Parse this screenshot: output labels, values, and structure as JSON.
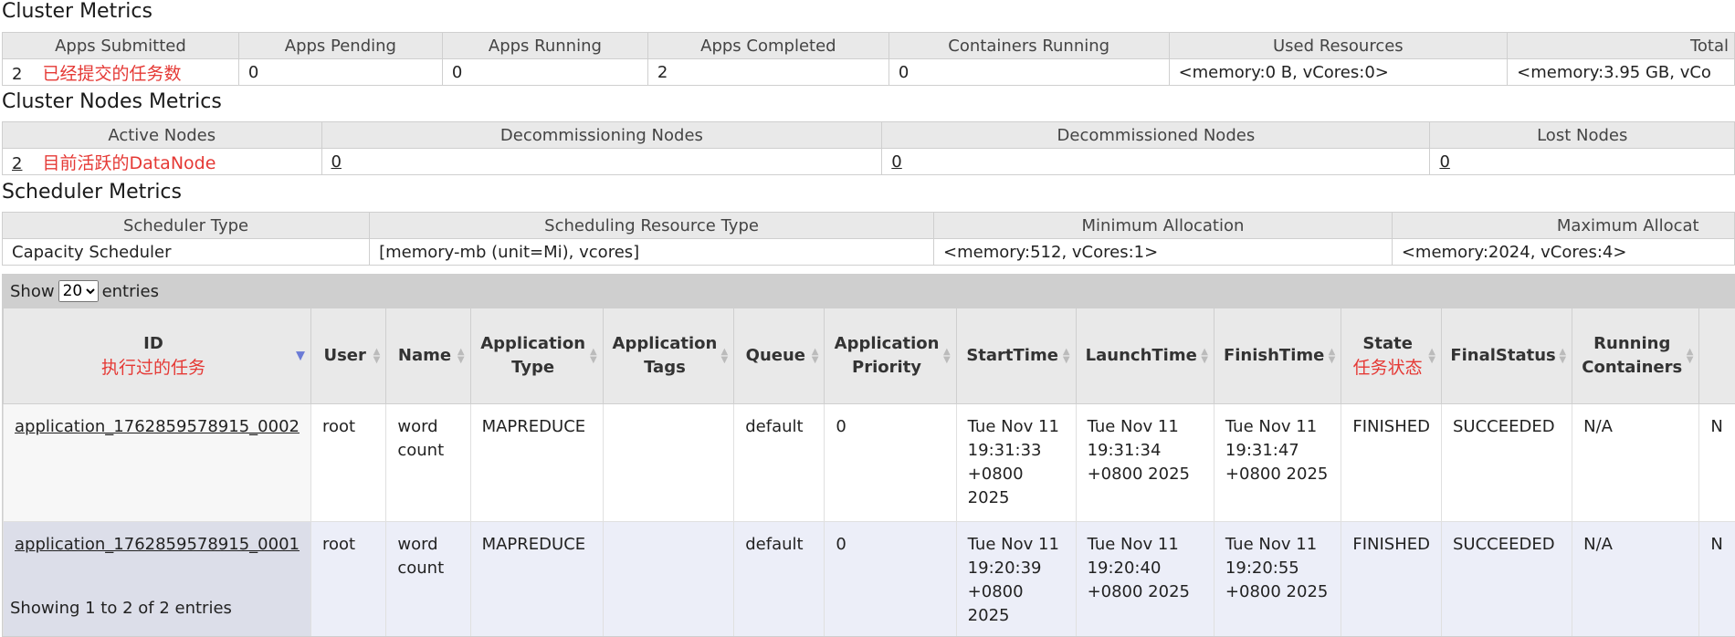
{
  "cluster_metrics": {
    "title": "Cluster Metrics",
    "headers": [
      "Apps Submitted",
      "Apps Pending",
      "Apps Running",
      "Apps Completed",
      "Containers Running",
      "Used Resources",
      "Total"
    ],
    "values": [
      "2",
      "0",
      "0",
      "2",
      "0",
      "<memory:0 B, vCores:0>",
      "<memory:3.95 GB, vCo"
    ],
    "note": "已经提交的任务数"
  },
  "nodes_metrics": {
    "title": "Cluster Nodes Metrics",
    "headers": [
      "Active Nodes",
      "Decommissioning Nodes",
      "Decommissioned Nodes",
      "Lost Nodes"
    ],
    "values": [
      "2",
      "0",
      "0",
      "0"
    ],
    "note": "目前活跃的DataNode"
  },
  "scheduler_metrics": {
    "title": "Scheduler Metrics",
    "headers": [
      "Scheduler Type",
      "Scheduling Resource Type",
      "Minimum Allocation",
      "Maximum Allocat"
    ],
    "values": [
      "Capacity Scheduler",
      "[memory-mb (unit=Mi), vcores]",
      "<memory:512, vCores:1>",
      "<memory:2024, vCores:4>"
    ]
  },
  "apps_table": {
    "show_label": "Show",
    "entries_value": "20",
    "entries_label": "entries",
    "headers": {
      "id": "ID",
      "id_note": "执行过的任务",
      "user": "User",
      "name": "Name",
      "app_type": "Application Type",
      "app_tags": "Application Tags",
      "queue": "Queue",
      "priority": "Application Priority",
      "start": "StartTime",
      "launch": "LaunchTime",
      "finish": "FinishTime",
      "state": "State",
      "state_note": "任务状态",
      "final_status": "FinalStatus",
      "running": "Running Containers"
    },
    "rows": [
      {
        "id": "application_1762859578915_0002",
        "user": "root",
        "name": "word count",
        "type": "MAPREDUCE",
        "tags": "",
        "queue": "default",
        "priority": "0",
        "start": "Tue Nov 11 19:31:33 +0800 2025",
        "launch": "Tue Nov 11 19:31:34 +0800 2025",
        "finish": "Tue Nov 11 19:31:47 +0800 2025",
        "state": "FINISHED",
        "final_status": "SUCCEEDED",
        "running": "N/A",
        "next": "N"
      },
      {
        "id": "application_1762859578915_0001",
        "user": "root",
        "name": "word count",
        "type": "MAPREDUCE",
        "tags": "",
        "queue": "default",
        "priority": "0",
        "start": "Tue Nov 11 19:20:39 +0800 2025",
        "launch": "Tue Nov 11 19:20:40 +0800 2025",
        "finish": "Tue Nov 11 19:20:55 +0800 2025",
        "state": "FINISHED",
        "final_status": "SUCCEEDED",
        "running": "N/A",
        "next": "N"
      }
    ],
    "footer": "Showing 1 to 2 of 2 entries"
  }
}
